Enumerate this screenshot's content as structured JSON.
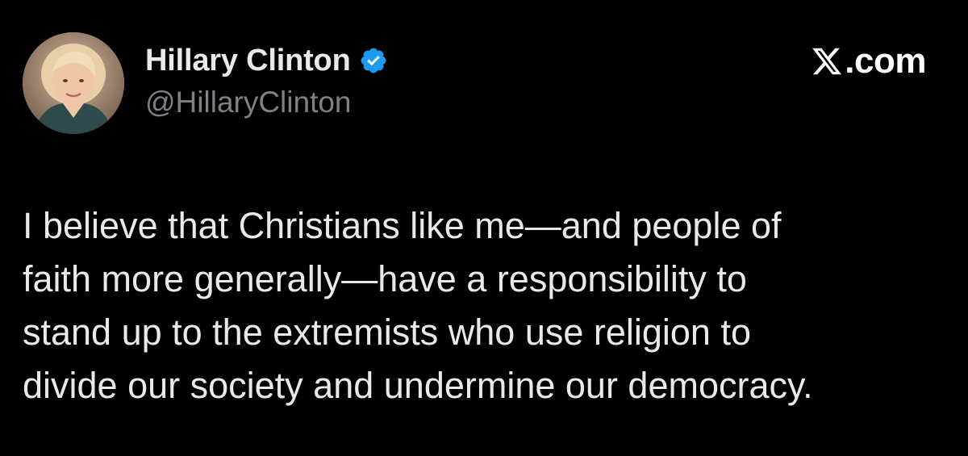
{
  "author": {
    "display_name": "Hillary Clinton",
    "handle": "@HillaryClinton",
    "verified": true,
    "avatar_icon": "profile-photo",
    "verified_icon": "verified-badge-icon"
  },
  "brand": {
    "logo_icon": "x-logo-icon",
    "label": ".com"
  },
  "tweet": {
    "lines": [
      "I believe that Christians like me—and people of",
      "faith more generally—have a responsibility to",
      "stand up to the extremists who use religion to",
      "divide our society and undermine our democracy."
    ]
  },
  "colors": {
    "background": "#000000",
    "text": "#e7e9ea",
    "secondary_text": "#7d8186",
    "verified_blue": "#1d9bf0"
  }
}
